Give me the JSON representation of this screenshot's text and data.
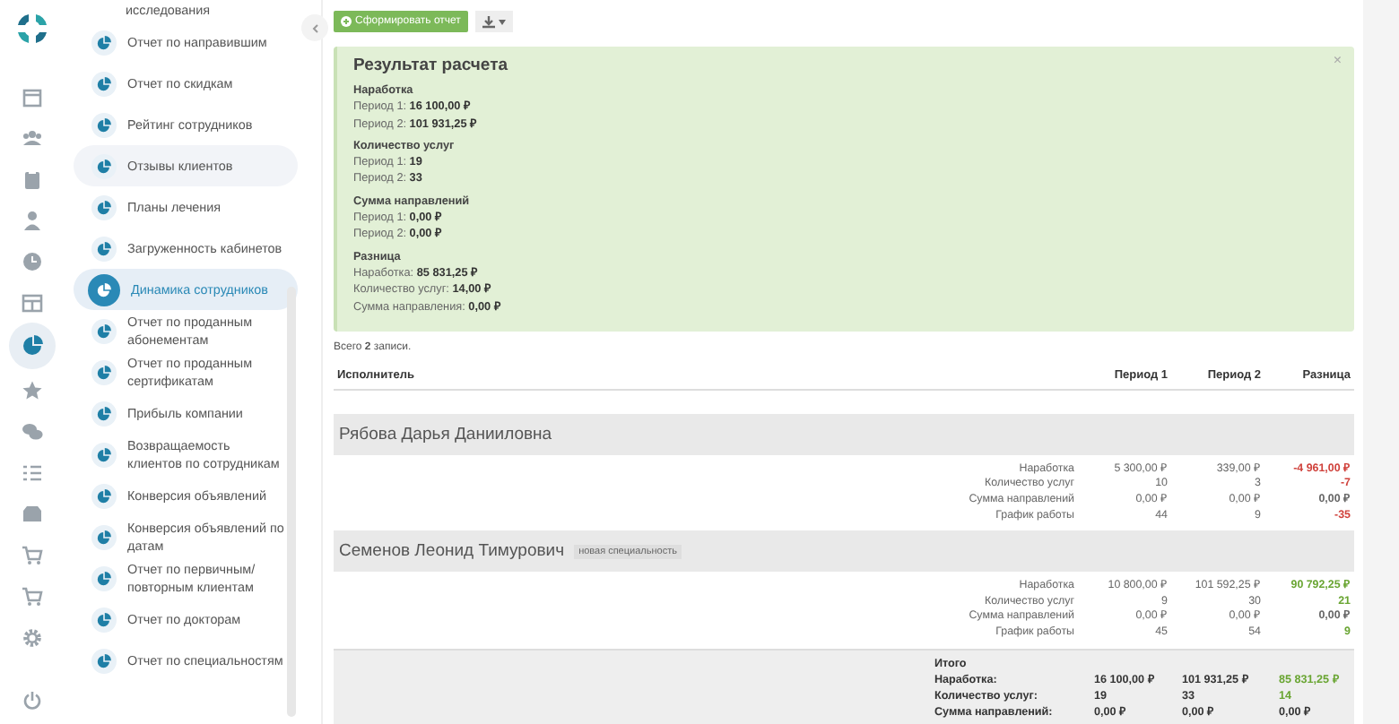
{
  "rail": [
    {
      "selected": false
    },
    {
      "selected": false
    },
    {
      "selected": false
    },
    {
      "selected": false
    },
    {
      "selected": false
    },
    {
      "selected": false
    },
    {
      "selected": true
    },
    {
      "selected": false
    },
    {
      "selected": false
    },
    {
      "selected": false
    },
    {
      "selected": false
    },
    {
      "selected": false
    },
    {
      "selected": false
    },
    {
      "selected": false
    }
  ],
  "menu": [
    {
      "kind": "continuation",
      "label": "исследования",
      "selected": false,
      "hovered": false
    },
    {
      "kind": "report",
      "label": "Отчет по направившим",
      "selected": false,
      "hovered": false
    },
    {
      "kind": "report",
      "label": "Отчет по скидкам",
      "selected": false,
      "hovered": false
    },
    {
      "kind": "report",
      "label": "Рейтинг сотрудников",
      "selected": false,
      "hovered": false
    },
    {
      "kind": "report",
      "label": "Отзывы клиентов",
      "selected": false,
      "hovered": true
    },
    {
      "kind": "report",
      "label": "Планы лечения",
      "selected": false,
      "hovered": false
    },
    {
      "kind": "report",
      "label": "Загруженность кабинетов",
      "selected": false,
      "hovered": false
    },
    {
      "kind": "report",
      "label": "Динамика сотрудников",
      "selected": true,
      "hovered": false
    },
    {
      "kind": "report",
      "label": "Отчет по проданным абонементам",
      "selected": false,
      "hovered": false
    },
    {
      "kind": "report",
      "label": "Отчет по проданным сертификатам",
      "selected": false,
      "hovered": false
    },
    {
      "kind": "report",
      "label": "Прибыль компании",
      "selected": false,
      "hovered": false
    },
    {
      "kind": "report",
      "label": "Возвращаемость клиентов по сотрудникам",
      "selected": false,
      "hovered": false
    },
    {
      "kind": "report",
      "label": "Конверсия объявлений",
      "selected": false,
      "hovered": false
    },
    {
      "kind": "report",
      "label": "Конверсия объявлений по датам",
      "selected": false,
      "hovered": false
    },
    {
      "kind": "report",
      "label": "Отчет по первичным/ повторным клиентам",
      "selected": false,
      "hovered": false
    },
    {
      "kind": "report",
      "label": "Отчет по докторам",
      "selected": false,
      "hovered": false
    },
    {
      "kind": "report",
      "label": "Отчет по специальностям",
      "selected": false,
      "hovered": false
    }
  ],
  "toolbar": {
    "generate_button": "Сформировать отчет"
  },
  "alert": {
    "title": "Результат расчета",
    "close": "×",
    "sections": [
      {
        "heading": "Наработка",
        "lines": [
          "Период 1: **16 100,00 ₽**",
          "Период 2: **101 931,25 ₽**"
        ]
      },
      {
        "heading": "Количество услуг",
        "lines": [
          "Период 1: **19**",
          "Период 2: **33**"
        ]
      },
      {
        "heading": "Сумма направлений",
        "lines": [
          "Период 1: **0,00 ₽**",
          "Период 2: **0,00 ₽**"
        ]
      },
      {
        "heading": "Разница",
        "lines": [
          "Наработка: **85 831,25 ₽**",
          "Количество услуг: **14,00 ₽**",
          "Сумма направления: **0,00 ₽**"
        ]
      }
    ]
  },
  "summary": "Всего **2** записи.",
  "table": {
    "columns": [
      "Исполнитель",
      "Период 1",
      "Период 2",
      "Разница"
    ],
    "groups": [
      {
        "name": "Рябова Дарья Данииловна",
        "metrics": [
          {
            "label": "Наработка",
            "period_1": "5 300,00 ₽",
            "period_2": "339,00 ₽",
            "difference": "-4 961,00 ₽",
            "color": "#d0423c"
          },
          {
            "label": "Количество услуг",
            "period_1": "10",
            "period_2": "3",
            "difference": "-7",
            "color": "#d0423c"
          },
          {
            "label": "Сумма направлений",
            "period_1": "0,00 ₽",
            "period_2": "0,00 ₽",
            "difference": "0,00 ₽",
            "color": "#666666"
          },
          {
            "label": "График работы",
            "period_1": "44",
            "period_2": "9",
            "difference": "-35",
            "color": "#d0423c"
          }
        ]
      },
      {
        "name": "Семенов Леонид Тимурович",
        "badge": "новая специальность",
        "metrics": [
          {
            "label": "Наработка",
            "period_1": "10 800,00 ₽",
            "period_2": "101 592,25 ₽",
            "difference": "90 792,25 ₽",
            "color": "#69a532"
          },
          {
            "label": "Количество услуг",
            "period_1": "9",
            "period_2": "30",
            "difference": "21",
            "color": "#69a532"
          },
          {
            "label": "Сумма направлений",
            "period_1": "0,00 ₽",
            "period_2": "0,00 ₽",
            "difference": "0,00 ₽",
            "color": "#666666"
          },
          {
            "label": "График работы",
            "period_1": "45",
            "period_2": "54",
            "difference": "9",
            "color": "#69a532"
          }
        ]
      }
    ],
    "totals": {
      "title": "Итого",
      "rows": [
        {
          "label": "Наработка:",
          "period_1": "16 100,00 ₽",
          "period_2": "101 931,25 ₽",
          "difference": "85 831,25 ₽",
          "color": "#69a532"
        },
        {
          "label": "Количество услуг:",
          "period_1": "19",
          "period_2": "33",
          "difference": "14",
          "color": "#69a532"
        },
        {
          "label": "Сумма направлений:",
          "period_1": "0,00 ₽",
          "period_2": "0,00 ₽",
          "difference": "0,00 ₽",
          "color": "#333333"
        }
      ]
    }
  }
}
